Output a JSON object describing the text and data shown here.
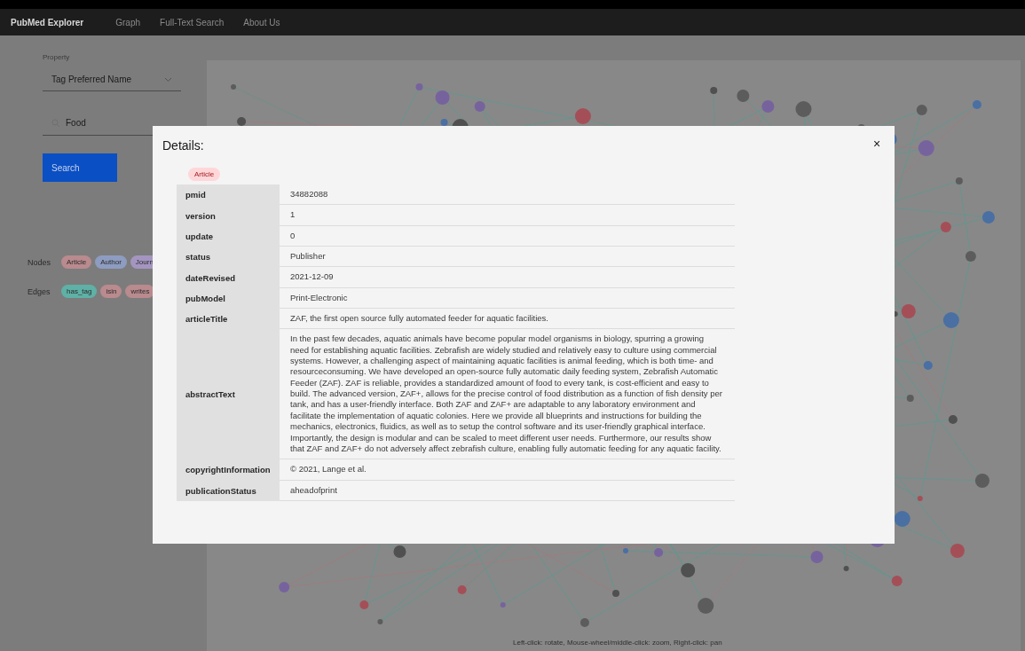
{
  "navbar": {
    "brand": "PubMed Explorer",
    "links": [
      "Graph",
      "Full-Text Search",
      "About Us"
    ]
  },
  "sidebar": {
    "property": {
      "label": "Property",
      "value": "Tag Preferred Name"
    },
    "search": {
      "value": "Food"
    },
    "search_button": "Search",
    "nodes": {
      "label": "Nodes",
      "items": [
        {
          "label": "Article",
          "color": "#b98a8e"
        },
        {
          "label": "Author",
          "color": "#8d9cc0"
        },
        {
          "label": "Journ",
          "color": "#a495c0"
        }
      ]
    },
    "edges": {
      "label": "Edges",
      "items": [
        {
          "label": "has_tag",
          "color": "#5fb0a6"
        },
        {
          "label": "isin",
          "color": "#b98a8e"
        },
        {
          "label": "writes",
          "color": "#b98a8e"
        }
      ]
    }
  },
  "graph": {
    "hint": "Left-click: rotate, Mouse-wheel/middle-click: zoom, Right-click: pan"
  },
  "dialog": {
    "title": "Details:",
    "close": "×",
    "tag": "Article",
    "rows": [
      {
        "key": "pmid",
        "value": "34882088"
      },
      {
        "key": "version",
        "value": "1"
      },
      {
        "key": "update",
        "value": "0"
      },
      {
        "key": "status",
        "value": "Publisher"
      },
      {
        "key": "dateRevised",
        "value": "2021-12-09"
      },
      {
        "key": "pubModel",
        "value": "Print-Electronic"
      },
      {
        "key": "articleTitle",
        "value": "ZAF, the first open source fully automated feeder for aquatic facilities."
      },
      {
        "key": "abstractText",
        "value": "In the past few decades, aquatic animals have become popular model organisms in biology, spurring a growing need for establishing aquatic facilities. Zebrafish are widely studied and relatively easy to culture using commercial systems. However, a challenging aspect of maintaining aquatic facilities is animal feeding, which is both time- and resourceconsuming. We have developed an open-source fully automatic daily feeding system, Zebrafish Automatic Feeder (ZAF). ZAF is reliable, provides a standardized amount of food to every tank, is cost-efficient and easy to build. The advanced version, ZAF+, allows for the precise control of food distribution as a function of fish density per tank, and has a user-friendly interface. Both ZAF and ZAF+ are adaptable to any laboratory environment and facilitate the implementation of aquatic colonies. Here we provide all blueprints and instructions for building the mechanics, electronics, fluidics, as well as to setup the control software and its user-friendly graphical interface. Importantly, the design is modular and can be scaled to meet different user needs. Furthermore, our results show that ZAF and ZAF+ do not adversely affect zebrafish culture, enabling fully automatic feeding for any aquatic facility."
      },
      {
        "key": "copyrightInformation",
        "value": "© 2021, Lange et al."
      },
      {
        "key": "publicationStatus",
        "value": "aheadofprint"
      }
    ]
  }
}
